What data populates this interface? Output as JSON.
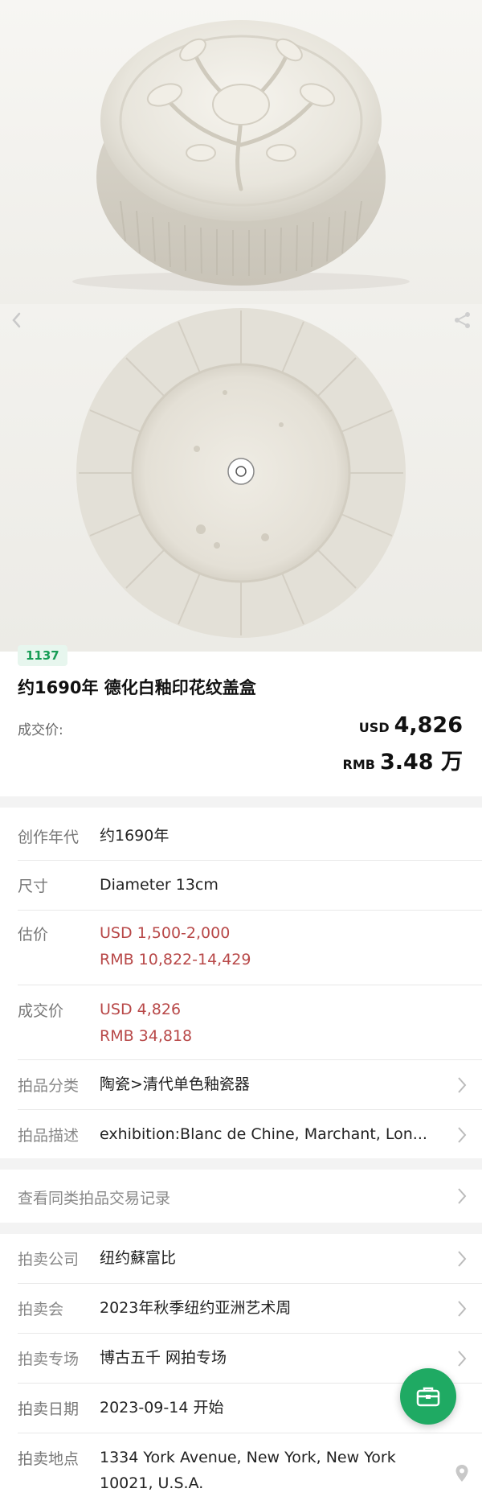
{
  "nav": {
    "back_icon": "chevron-left-icon",
    "share_icon": "share-icon"
  },
  "lot": {
    "number": "1137",
    "title": "约1690年 德化白釉印花纹盖盒",
    "deal_label": "成交价:",
    "usd_currency": "USD",
    "usd_amount": "4,826",
    "rmb_currency": "RMB",
    "rmb_amount": "3.48 万"
  },
  "details": {
    "year": {
      "label": "创作年代",
      "value": "约1690年"
    },
    "size": {
      "label": "尺寸",
      "value": "Diameter 13cm"
    },
    "estimate": {
      "label": "估价",
      "usd": "USD  1,500-2,000",
      "rmb": "RMB 10,822-14,429"
    },
    "sold": {
      "label": "成交价",
      "usd": "USD 4,826",
      "rmb": "RMB 34,818"
    },
    "category": {
      "label": "拍品分类",
      "value": "陶瓷>清代单色釉瓷器"
    },
    "description": {
      "label": "拍品描述",
      "value": "exhibition:Blanc de Chine, Marchant, Lon..."
    }
  },
  "similar_records": {
    "label": "查看同类拍品交易记录"
  },
  "auction": {
    "company": {
      "label": "拍卖公司",
      "value": "纽约蘇富比"
    },
    "sale": {
      "label": "拍卖会",
      "value": "2023年秋季纽约亚洲艺术周"
    },
    "session": {
      "label": "拍卖专场",
      "value": "博古五千 网拍专场"
    },
    "date": {
      "label": "拍卖日期",
      "value": "2023-09-14  开始"
    },
    "location": {
      "label": "拍卖地点",
      "line1": "1334 York Avenue, New York, New York",
      "line2": "10021, U.S.A."
    }
  },
  "colors": {
    "accent_green": "#1faa63",
    "price_red": "#b84848"
  }
}
